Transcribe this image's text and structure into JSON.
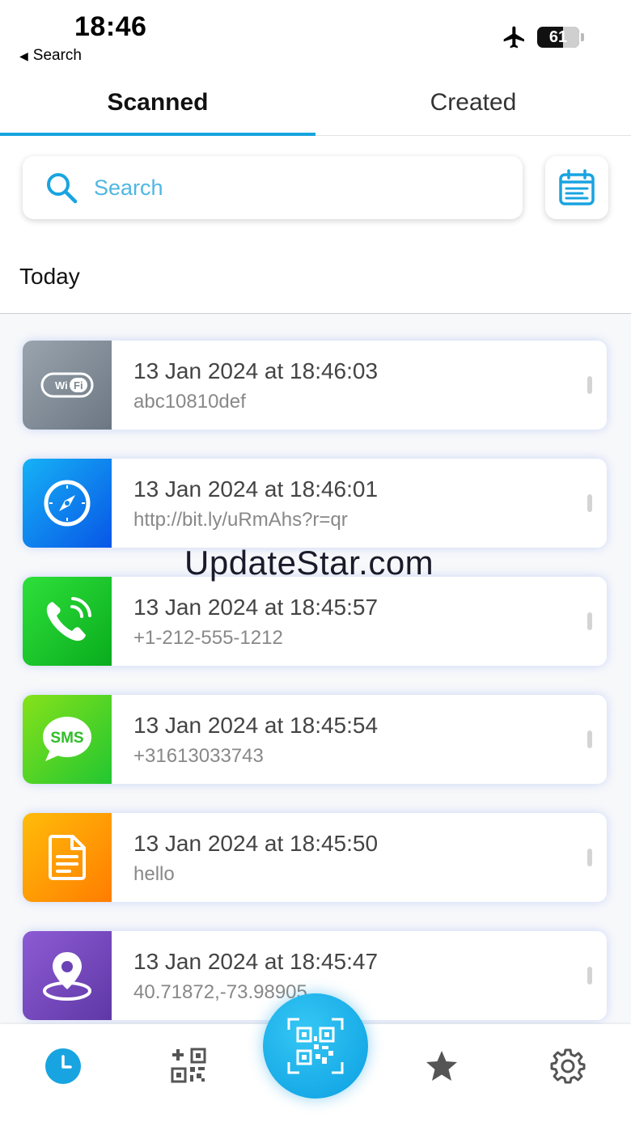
{
  "status_bar": {
    "time": "18:46",
    "back_label": "Search",
    "battery": "61",
    "battery_level": 0.61
  },
  "tabs": [
    {
      "label": "Scanned",
      "active": true
    },
    {
      "label": "Created",
      "active": false
    }
  ],
  "search": {
    "placeholder": "Search"
  },
  "section": {
    "title": "Today"
  },
  "history": [
    {
      "type": "wifi",
      "icon": "wifi-icon",
      "date": "13 Jan 2024 at 18:46:03",
      "value": "abc10810def"
    },
    {
      "type": "url",
      "icon": "compass-icon",
      "date": "13 Jan 2024 at 18:46:01",
      "value": "http://bit.ly/uRmAhs?r=qr"
    },
    {
      "type": "phone",
      "icon": "phone-icon",
      "date": "13 Jan 2024 at 18:45:57",
      "value": "+1-212-555-1212"
    },
    {
      "type": "sms",
      "icon": "sms-icon",
      "date": "13 Jan 2024 at 18:45:54",
      "value": "+31613033743"
    },
    {
      "type": "text",
      "icon": "document-icon",
      "date": "13 Jan 2024 at 18:45:50",
      "value": "hello"
    },
    {
      "type": "location",
      "icon": "location-pin-icon",
      "date": "13 Jan 2024 at 18:45:47",
      "value": "40.71872,-73.98905"
    }
  ],
  "icon_text": {
    "wifi_wi": "Wi",
    "wifi_fi": "Fi",
    "sms": "SMS"
  },
  "watermark": "UpdateStar.com",
  "bottom_nav": [
    {
      "name": "history",
      "icon": "clock-icon",
      "active": true
    },
    {
      "name": "create",
      "icon": "qr-add-icon",
      "active": false
    },
    {
      "name": "scan",
      "icon": "qr-scan-icon",
      "active": false
    },
    {
      "name": "favorites",
      "icon": "star-icon",
      "active": false
    },
    {
      "name": "settings",
      "icon": "gear-icon",
      "active": false
    }
  ],
  "colors": {
    "accent": "#18a4e0",
    "wifi": "#7d8893",
    "url": "#0d86ef",
    "phone": "#1cc52c",
    "sms": "#55d424",
    "text": "#ff9c05",
    "location": "#7348bd"
  }
}
